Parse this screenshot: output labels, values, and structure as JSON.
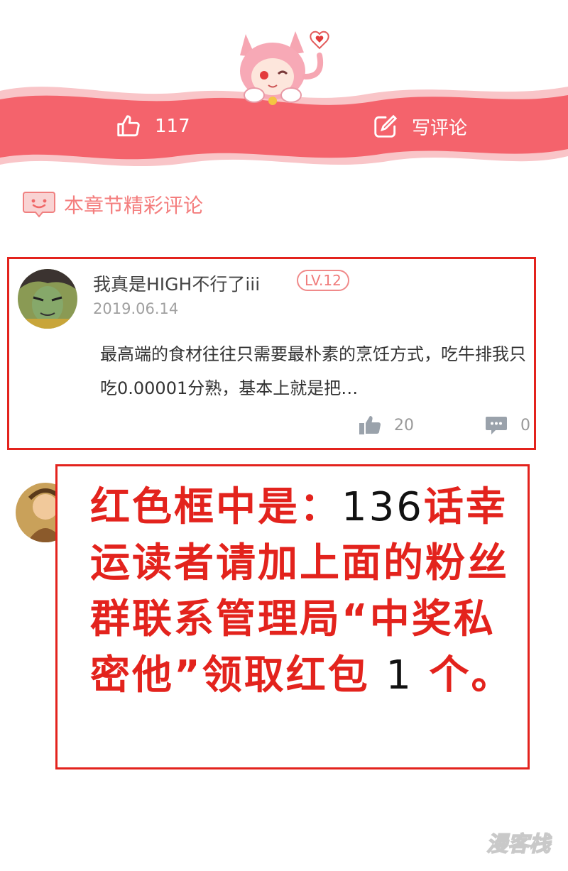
{
  "header": {
    "like_count": "117",
    "write_comment_label": "写评论"
  },
  "section": {
    "title": "本章节精彩评论"
  },
  "comment": {
    "username": "我真是HIGH不行了iii",
    "level": "LV.12",
    "date": "2019.06.14",
    "body": "最高端的食材往往只需要最朴素的烹饪方式，吃牛排我只吃0.00001分熟，基本上就是把…",
    "likes": "20",
    "replies": "0"
  },
  "notice": {
    "part1": "红色框中是：",
    "number": "136",
    "part2": "话幸运读者请加上面的粉丝群联系管理局“中奖私密他”领取红包",
    "count": "1",
    "part3": "个。"
  },
  "watermark": {
    "text": "漫客栈"
  },
  "colors": {
    "banner_pink": "#f4636c",
    "accent_red": "#e3231d",
    "section_pink": "#f47e7e"
  },
  "icons": [
    "thumbs-up-icon",
    "edit-icon",
    "comment-bubble-icon",
    "thumbs-up-filled-icon",
    "reply-bubble-icon"
  ]
}
